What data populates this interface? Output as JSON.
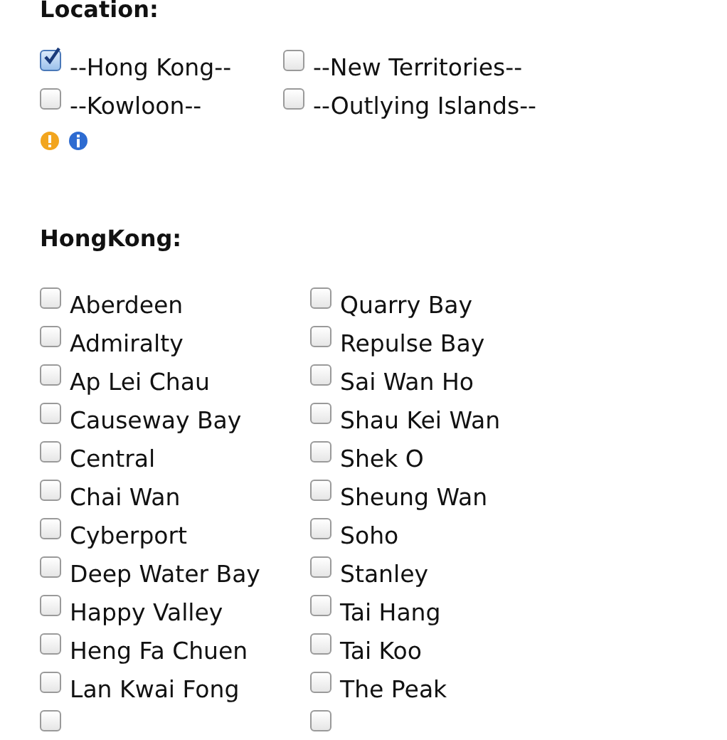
{
  "location": {
    "title": "Location:",
    "options": [
      {
        "label": "--Hong Kong--",
        "checked": true
      },
      {
        "label": "--New Territories--",
        "checked": false
      },
      {
        "label": "--Kowloon--",
        "checked": false
      },
      {
        "label": "--Outlying Islands--",
        "checked": false
      }
    ]
  },
  "district": {
    "title": "HongKong:",
    "columns": [
      [
        {
          "label": "Aberdeen",
          "checked": false
        },
        {
          "label": "Admiralty",
          "checked": false
        },
        {
          "label": "Ap Lei Chau",
          "checked": false
        },
        {
          "label": "Causeway Bay",
          "checked": false
        },
        {
          "label": "Central",
          "checked": false
        },
        {
          "label": "Chai Wan",
          "checked": false
        },
        {
          "label": "Cyberport",
          "checked": false
        },
        {
          "label": "Deep Water Bay",
          "checked": false
        },
        {
          "label": "Happy Valley",
          "checked": false
        },
        {
          "label": "Heng Fa Chuen",
          "checked": false
        },
        {
          "label": "Lan Kwai Fong",
          "checked": false
        },
        {
          "checked": false
        }
      ],
      [
        {
          "label": "Quarry Bay",
          "checked": false
        },
        {
          "label": "Repulse Bay",
          "checked": false
        },
        {
          "label": "Sai Wan Ho",
          "checked": false
        },
        {
          "label": "Shau Kei Wan",
          "checked": false
        },
        {
          "label": "Shek O",
          "checked": false
        },
        {
          "label": "Sheung Wan",
          "checked": false
        },
        {
          "label": "Soho",
          "checked": false
        },
        {
          "label": "Stanley",
          "checked": false
        },
        {
          "label": "Tai Hang",
          "checked": false
        },
        {
          "label": "Tai Koo",
          "checked": false
        },
        {
          "label": "The Peak",
          "checked": false
        },
        {
          "checked": false
        }
      ]
    ]
  }
}
